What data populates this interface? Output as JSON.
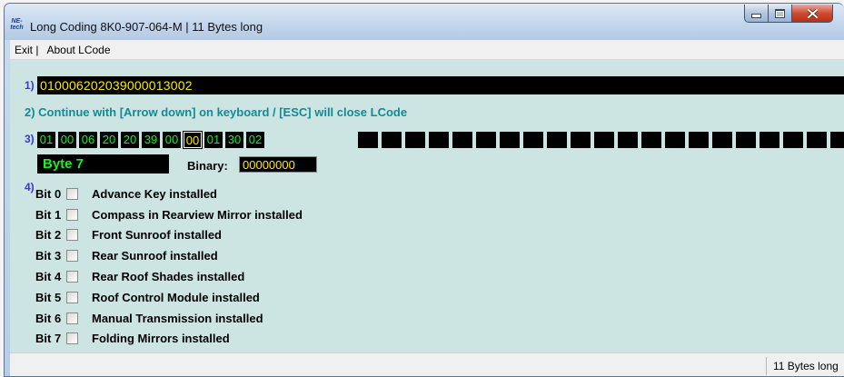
{
  "window": {
    "title": "Long Coding  8K0-907-064-M | 11 Bytes long",
    "icon_text_top": "NE-",
    "icon_text_bottom": "tech"
  },
  "menu": {
    "items": [
      "Exit |",
      "About LCode"
    ]
  },
  "section_labels": {
    "s1": "1)",
    "s2": "2)",
    "s3": "3)",
    "s4": "4)"
  },
  "coding_string": "010006202039000013002",
  "instruction": "2) Continue with [Arrow down] on keyboard / [ESC] will close LCode",
  "bytes": [
    "01",
    "00",
    "06",
    "20",
    "20",
    "39",
    "00",
    "00",
    "01",
    "30",
    "02"
  ],
  "selected_byte_index": 7,
  "byte_label": "Byte 7",
  "binary_label": "Binary:",
  "binary_value": "00000000",
  "bits": [
    {
      "label": "Bit 0",
      "desc": "Advance Key installed",
      "checked": false
    },
    {
      "label": "Bit 1",
      "desc": "Compass in Rearview Mirror installed",
      "checked": false
    },
    {
      "label": "Bit 2",
      "desc": "Front Sunroof installed",
      "checked": false
    },
    {
      "label": "Bit 3",
      "desc": "Rear Sunroof installed",
      "checked": false
    },
    {
      "label": "Bit 4",
      "desc": "Rear Roof Shades installed",
      "checked": false
    },
    {
      "label": "Bit 5",
      "desc": "Roof Control Module installed",
      "checked": false
    },
    {
      "label": "Bit 6",
      "desc": "Manual Transmission installed",
      "checked": false
    },
    {
      "label": "Bit 7",
      "desc": "Folding Mirrors installed",
      "checked": false
    }
  ],
  "status": {
    "text": "11 Bytes long"
  },
  "colors": {
    "byte_text": "#14f024",
    "selected_byte_text": "#ffe800",
    "coding_text": "#ffe800",
    "instruction_text": "#138a93",
    "section_label": "#3a36e0",
    "client_bg": "#cce5e3"
  }
}
